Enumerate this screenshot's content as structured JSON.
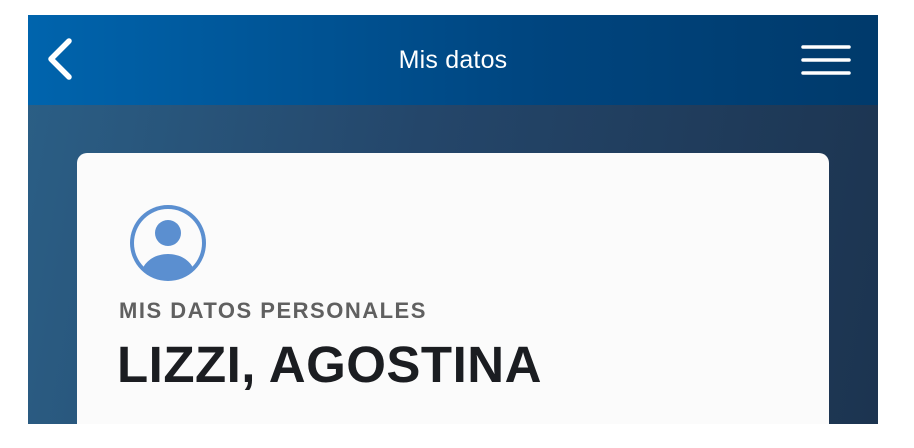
{
  "header": {
    "title": "Mis datos",
    "back_icon": "chevron-left-icon",
    "menu_icon": "hamburger-menu-icon"
  },
  "profile": {
    "avatar_icon": "user-avatar-icon",
    "section_label": "MIS DATOS PERSONALES",
    "name": "LIZZI, AGOSTINA"
  },
  "colors": {
    "header_start": "#0064ad",
    "header_end": "#003a6b",
    "background_start": "#2b5f86",
    "background_end": "#1c3450",
    "card": "#fbfbfb",
    "avatar": "#5b8fd0",
    "label": "#606060",
    "name": "#1b1d21"
  }
}
